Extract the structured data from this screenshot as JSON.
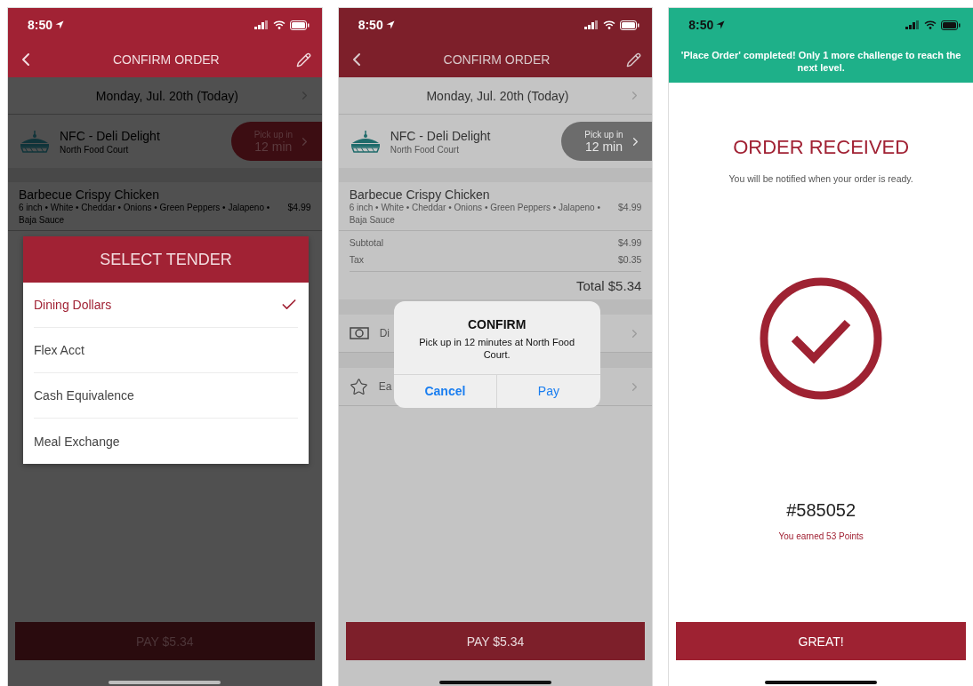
{
  "screens": [
    {
      "kind": "tender",
      "status_time": "8:50",
      "header": {
        "title": "CONFIRM ORDER"
      },
      "date": "Monday, Jul. 20th (Today)",
      "restaurant": {
        "name": "NFC - Deli Delight",
        "location": "North Food Court",
        "pickup_label": "Pick up in",
        "pickup_time": "12 min"
      },
      "item": {
        "name": "Barbecue Crispy Chicken",
        "options": "6 inch • White • Cheddar • Onions • Green Peppers • Jalapeno • Baja Sauce",
        "price": "$4.99"
      },
      "dialog": {
        "title": "SELECT TENDER",
        "options": [
          {
            "label": "Dining Dollars",
            "selected": true
          },
          {
            "label": "Flex Acct",
            "selected": false
          },
          {
            "label": "Cash Equivalence",
            "selected": false
          },
          {
            "label": "Meal Exchange",
            "selected": false
          }
        ]
      },
      "pay_button": "PAY $5.34"
    },
    {
      "kind": "alert",
      "status_time": "8:50",
      "header": {
        "title": "CONFIRM ORDER"
      },
      "date": "Monday, Jul. 20th (Today)",
      "restaurant": {
        "name": "NFC - Deli Delight",
        "location": "North Food Court",
        "pickup_label": "Pick up in",
        "pickup_time": "12 min"
      },
      "item": {
        "name": "Barbecue Crispy Chicken",
        "options": "6 inch • White • Cheddar • Onions • Green Peppers • Jalapeno • Baja Sauce",
        "price": "$4.99"
      },
      "totals": [
        {
          "label": "Subtotal",
          "value": "$4.99"
        },
        {
          "label": "Tax",
          "value": "$0.35"
        }
      ],
      "total": "Total $5.34",
      "payment_row": "Di",
      "points_row": "Ea",
      "alert": {
        "title": "CONFIRM",
        "message": "Pick up in 12 minutes at North Food Court.",
        "buttons": [
          {
            "label": "Cancel",
            "kind": "cancel"
          },
          {
            "label": "Pay",
            "kind": "default"
          }
        ]
      },
      "pay_button": "PAY $5.34"
    },
    {
      "kind": "received",
      "status_time": "8:50",
      "banner": "'Place Order' completed! Only 1 more challenge to reach the next level.",
      "title": "ORDER RECEIVED",
      "subtitle": "You will be notified when your order is ready.",
      "order_number": "#585052",
      "points": "You earned 53 Points",
      "button": "GREAT!"
    }
  ]
}
